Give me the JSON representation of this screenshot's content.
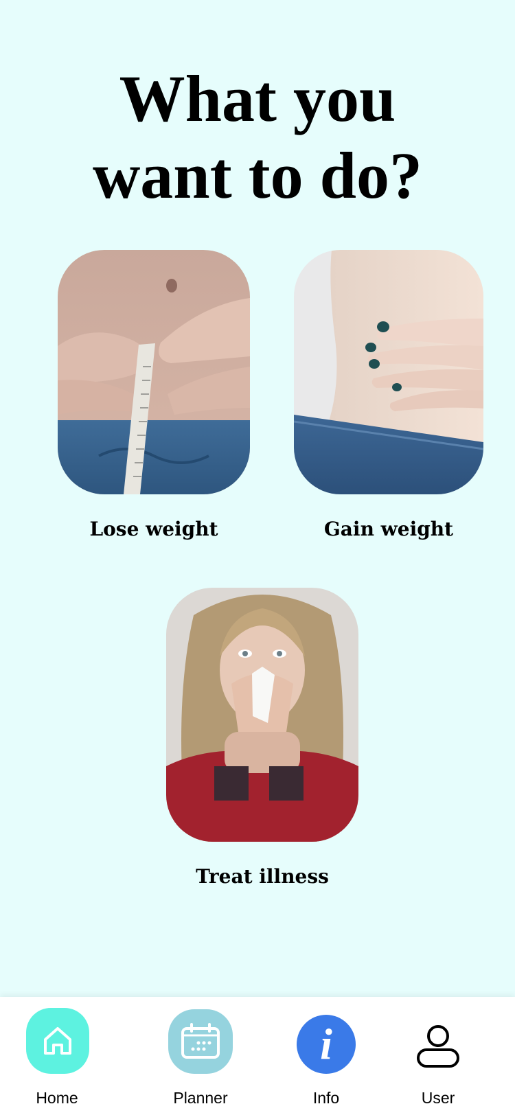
{
  "page": {
    "title_line1": "What you",
    "title_line2": "want to do?"
  },
  "options": [
    {
      "label": "Lose weight",
      "image": "waist-measuring-tape-photo"
    },
    {
      "label": "Gain weight",
      "image": "slim-waist-jeans-photo"
    },
    {
      "label": "Treat illness",
      "image": "woman-sneezing-tissue-photo"
    }
  ],
  "bottom_nav": {
    "items": [
      {
        "label": "Home",
        "icon": "home-icon",
        "bg": "#5df2e0"
      },
      {
        "label": "Planner",
        "icon": "calendar-icon",
        "bg": "#95d3de"
      },
      {
        "label": "Info",
        "icon": "info-icon",
        "bg": "#3a7ae8"
      },
      {
        "label": "User",
        "icon": "user-icon"
      }
    ]
  },
  "colors": {
    "background": "#e6fdfc",
    "nav_background": "#ffffff"
  }
}
